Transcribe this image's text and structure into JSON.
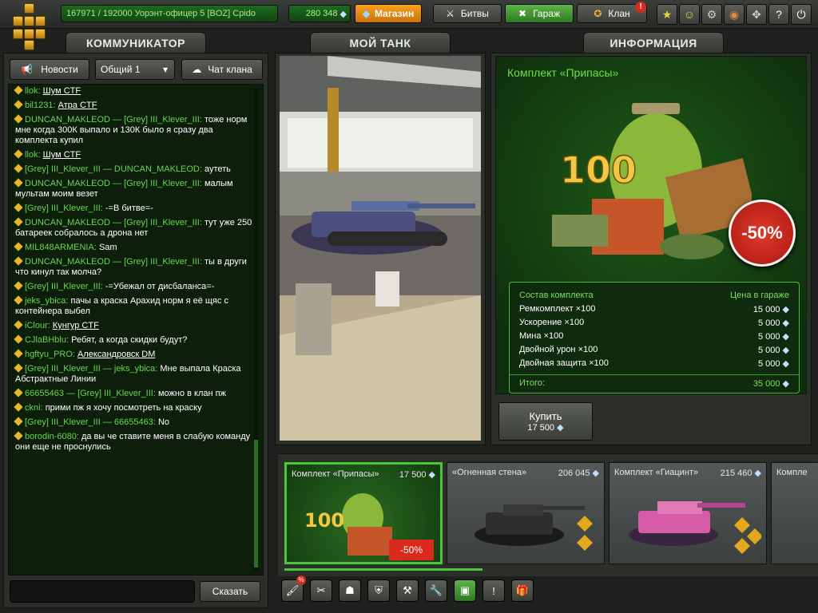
{
  "top": {
    "rank": "167971 / 192000  Уорэнт-офицер 5 [BOZ] Cpido",
    "crystals": "280 348",
    "shop_label": "Магазин",
    "battles_label": "Битвы",
    "garage_label": "Гараж",
    "clan_label": "Клан",
    "clan_badge": "!",
    "icons": [
      "star-icon",
      "friends-icon",
      "settings-icon",
      "sound-icon",
      "fullscreen-icon",
      "help-icon"
    ],
    "help_label": "?"
  },
  "headers": {
    "communicator": "КОММУНИКАТОР",
    "tank": "МОЙ ТАНК",
    "info": "ИНФОРМАЦИЯ"
  },
  "chat": {
    "news_label": "Новости",
    "channel": "Общий 1",
    "clan_chat_label": "Чат клана",
    "say_label": "Сказать",
    "messages": [
      {
        "user": "llok:",
        "link": "Шум CTF",
        "text": ""
      },
      {
        "user": "bil1231:",
        "link": "Атра CTF",
        "text": ""
      },
      {
        "user": "DUNCAN_MAKLEOD —",
        "to": "[Grey] III_Klever_III:",
        "text": "тоже норм мне когда 300К выпало и 130К было я сразу два комплекта купил"
      },
      {
        "user": "llok:",
        "link": "Шум CTF",
        "text": ""
      },
      {
        "user": "[Grey] III_Klever_III —",
        "to": "DUNCAN_MAKLEOD:",
        "text": "аутеть"
      },
      {
        "user": "DUNCAN_MAKLEOD —",
        "to": "[Grey] III_Klever_III:",
        "text": "малым мультам моим везет"
      },
      {
        "user": "[Grey] III_Klever_III:",
        "text": "-=В битве=-"
      },
      {
        "user": "DUNCAN_MAKLEOD —",
        "to": "[Grey] III_Klever_III:",
        "text": "тут уже 250 батареек собралось а дрона нет"
      },
      {
        "user": "MIL848ARMENIA:",
        "text": "Sam"
      },
      {
        "user": "DUNCAN_MAKLEOD —",
        "to": "[Grey] III_Klever_III:",
        "text": "ты в други что кинул так молча?"
      },
      {
        "user": "[Grey] III_Klever_III:",
        "text": "-=Убежал от дисбаланса=-"
      },
      {
        "user": "jeks_ybica:",
        "text": "пачы а краска Арахид норм я её щяс с контейнера выбел"
      },
      {
        "user": "iClour:",
        "link": "Кунгур CTF",
        "text": ""
      },
      {
        "user": "CJlaBHblu:",
        "text": "Ребят, а когда скидки будут?"
      },
      {
        "user": "hgftyu_PRO:",
        "link": "Александровск DM",
        "text": ""
      },
      {
        "user": "[Grey] III_Klever_III —",
        "to": "jeks_ybica:",
        "text": "Мне выпала Краска Абстрактные Линии"
      },
      {
        "user": "66655463 —",
        "to": "[Grey] III_Klever_III:",
        "text": "можно в клан пж"
      },
      {
        "user": "ckni:",
        "text": "прими пж я хочу посмотреть на краску"
      },
      {
        "user": "[Grey] III_Klever_III —",
        "to": "66655463:",
        "text": "No"
      },
      {
        "user": "borodin-6080:",
        "text": "да вы че ставите меня в слабую команду они еще не проснулись"
      }
    ]
  },
  "info": {
    "title": "Комплект «Припасы»",
    "art_number": "100",
    "discount": "-50%",
    "table_head": [
      "Состав комплекта",
      "Цена в гараже"
    ],
    "items": [
      {
        "name": "Ремкомплект ×100",
        "price": "15 000"
      },
      {
        "name": "Ускорение ×100",
        "price": "5 000"
      },
      {
        "name": "Мина ×100",
        "price": "5 000"
      },
      {
        "name": "Двойной урон ×100",
        "price": "5 000"
      },
      {
        "name": "Двойная защита ×100",
        "price": "5 000"
      }
    ],
    "total_label": "Итого:",
    "total": "35 000",
    "buy_label": "Купить",
    "buy_price": "17 500"
  },
  "shelf": [
    {
      "name": "Комплект «Припасы»",
      "price": "17 500",
      "badge": "-50%",
      "art": "100"
    },
    {
      "name": "«Огненная стена»",
      "price": "206 045"
    },
    {
      "name": "Комплект «Гиацинт»",
      "price": "215 460"
    },
    {
      "name": "Компле",
      "price": ""
    }
  ],
  "colors": {
    "accent": "#48c838",
    "discount": "#d82a1c",
    "shop": "#f7a21d"
  }
}
